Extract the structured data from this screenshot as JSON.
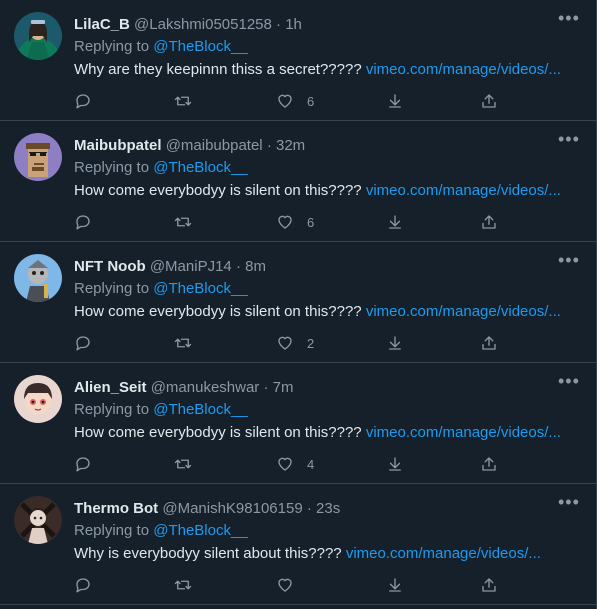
{
  "feed": {
    "tweets": [
      {
        "name": "LilaC_B",
        "handle": "@Lakshmi05051258",
        "dot": "·",
        "time": "1h",
        "replying_prefix": "Replying to ",
        "mention": "@TheBlock__",
        "text": "Why are they keepinnn thiss a secret?????",
        "link": "vimeo.com/manage/videos/...",
        "likes": "6",
        "avatar": "lila-avatar"
      },
      {
        "name": "Maibubpatel",
        "handle": "@maibubpatel",
        "dot": "·",
        "time": "32m",
        "replying_prefix": "Replying to ",
        "mention": "@TheBlock__",
        "text": "How come everybodyy is silent on this????",
        "link": "vimeo.com/manage/videos/...",
        "likes": "6",
        "avatar": "pixel-punk-avatar"
      },
      {
        "name": "NFT Noob",
        "handle": "@ManiPJ14",
        "dot": "·",
        "time": "8m",
        "replying_prefix": "Replying to ",
        "mention": "@TheBlock__",
        "text": "How come everybodyy is silent on this????",
        "link": "vimeo.com/manage/videos/...",
        "likes": "2",
        "avatar": "nft-noob-avatar"
      },
      {
        "name": "Alien_Seit",
        "handle": "@manukeshwar",
        "dot": "·",
        "time": "7m",
        "replying_prefix": "Replying to ",
        "mention": "@TheBlock__",
        "text": "How come everybodyy is silent on this????",
        "link": "vimeo.com/manage/videos/...",
        "likes": "4",
        "avatar": "anime-avatar"
      },
      {
        "name": "Thermo Bot",
        "handle": "@ManishK98106159",
        "dot": "·",
        "time": "23s",
        "replying_prefix": "Replying to ",
        "mention": "@TheBlock__",
        "text": "Why is everybodyy silent about this????",
        "link": "vimeo.com/manage/videos/...",
        "likes": "",
        "avatar": "bot-avatar"
      }
    ],
    "more_icon": "•••"
  },
  "colors": {
    "background": "#15202b",
    "divider": "#38444d",
    "link": "#1d9bf0",
    "muted": "#8b98a5",
    "text": "#e1e8ed"
  }
}
